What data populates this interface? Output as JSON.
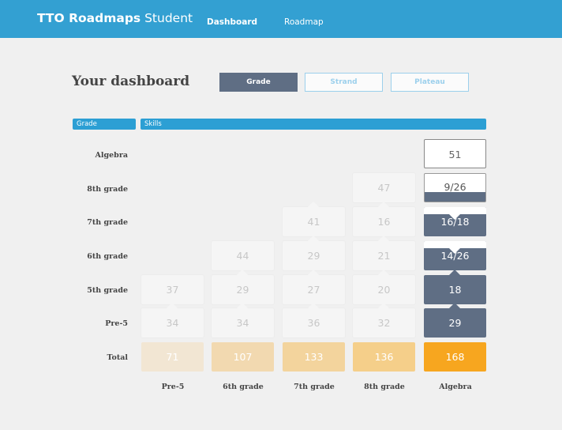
{
  "header": {
    "brand_bold": "TTO Roadmaps",
    "brand_rest": "Student",
    "nav": [
      "Dashboard",
      "Roadmap"
    ],
    "color": "#33a0d2"
  },
  "page": {
    "title": "Your dashboard",
    "tabs": [
      "Grade",
      "Strand",
      "Plateau"
    ],
    "active_tab": "Grade"
  },
  "table": {
    "col_header_left": "Grade",
    "col_header_right": "Skills",
    "row_labels": [
      "Algebra",
      "8th grade",
      "7th grade",
      "6th grade",
      "5th grade",
      "Pre-5",
      "Total"
    ],
    "col_labels": [
      "Pre-5",
      "6th grade",
      "7th grade",
      "8th grade",
      "Algebra"
    ],
    "cells": {
      "algebra_algebra": "51",
      "8th_8th": "47",
      "8th_algebra": "9/26",
      "7th_7th": "41",
      "7th_8th": "16",
      "7th_algebra": "16/18",
      "6th_6th": "44",
      "6th_7th": "29",
      "6th_8th": "21",
      "6th_algebra": "14/26",
      "5th_pre5": "37",
      "5th_6th": "29",
      "5th_7th": "27",
      "5th_8th": "20",
      "5th_algebra": "18",
      "pre5_pre5": "34",
      "pre5_6th": "34",
      "pre5_7th": "36",
      "pre5_8th": "32",
      "pre5_algebra": "29"
    },
    "totals": [
      "71",
      "107",
      "133",
      "136",
      "168"
    ],
    "total_colors": [
      "#f2e6d3",
      "#f2d9b0",
      "#f3d49d",
      "#f5cf8a",
      "#f7a61f"
    ],
    "dark_color": "#5f6e84"
  }
}
